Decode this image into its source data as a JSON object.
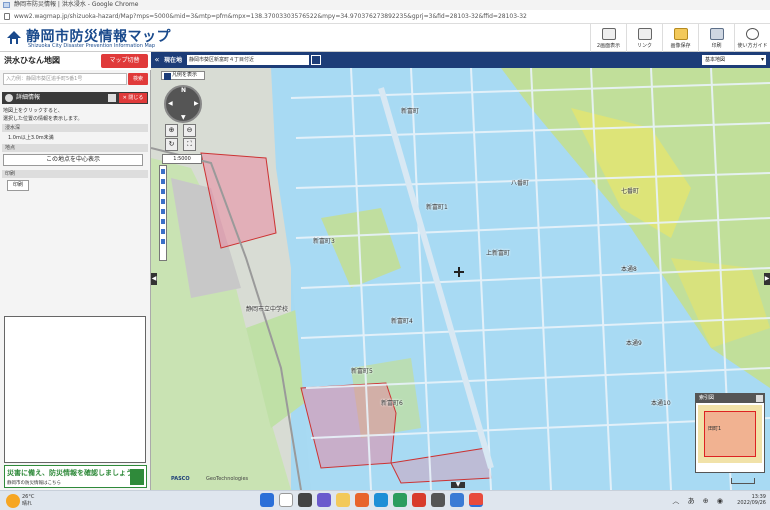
{
  "browser": {
    "title": "静岡市防災情報 | 洪水浸水 - Google Chrome",
    "url": "www2.wagmap.jp/shizuoka-hazard/Map?mps=5000&mid=3&mtp=pfm&mpx=138.37003303576522&mpy=34.970376273892235&gprj=3&fid=28103-32&ffid=28103-32"
  },
  "header": {
    "title": "静岡市防災情報マップ",
    "subtitle": "Shizuoka City Disaster Prevention Information Map",
    "buttons": [
      {
        "label": "2画面表示",
        "icon": "dual-screen-icon"
      },
      {
        "label": "リンク",
        "icon": "link-icon"
      },
      {
        "label": "画像保存",
        "icon": "folder-icon"
      },
      {
        "label": "印刷",
        "icon": "print-icon"
      },
      {
        "label": "使い方ガイド",
        "icon": "guide-icon"
      }
    ]
  },
  "sidebar": {
    "title": "洪水ひなん地図",
    "map_switch": "マップ切替",
    "search_placeholder": "入力例：静岡市葵区追手町5番1号",
    "search_button": "検索",
    "detail_title": "詳細情報",
    "close_label": "閉じる",
    "info_line1": "地図上をクリックすると、",
    "info_line2": "選択した位置の情報を表示します。",
    "section_depth": "浸水深",
    "depth_value": "1.0m以上3.0m未満",
    "section_point": "地点",
    "center_button": "この地点を中心表示",
    "section_print": "印刷",
    "print_button": "印刷",
    "banner_main": "災害に備え、防災情報を確認しましょう！",
    "banner_sub": "静岡市の防災情報はこちら"
  },
  "map_toolbar": {
    "current_label": "現在地",
    "current_value": "静岡市葵区新富町４丁目付近",
    "basemap": "基本地図"
  },
  "map": {
    "legend_tab": "凡例を表示",
    "scale": "1:5000",
    "labels": [
      {
        "text": "新富町",
        "id": "label-shintomicho"
      },
      {
        "text": "新富町1",
        "id": "label-shintomicho-1"
      },
      {
        "text": "新富町3",
        "id": "label-shintomicho-3"
      },
      {
        "text": "新富町4",
        "id": "label-shintomicho-4"
      },
      {
        "text": "新富町5",
        "id": "label-shintomicho-5"
      },
      {
        "text": "新富町6",
        "id": "label-shintomicho-6"
      },
      {
        "text": "上新富町",
        "id": "label-kamishintomicho"
      },
      {
        "text": "八番町",
        "id": "label-hachibancho"
      },
      {
        "text": "七番町",
        "id": "label-nanabancho"
      },
      {
        "text": "本通8",
        "id": "label-hondori-8"
      },
      {
        "text": "本通9",
        "id": "label-hondori-9"
      },
      {
        "text": "本通10",
        "id": "label-hondori-10"
      },
      {
        "text": "静岡市立中学校",
        "id": "label-school"
      }
    ],
    "overview_title": "索引図",
    "overview_text": "田町1",
    "credit_pasco": "PASCO",
    "credit_geo": "GeoTechnologies"
  },
  "taskbar": {
    "weather_temp": "26°C",
    "weather_desc": "晴れ",
    "time": "13:39",
    "date": "2022/09/26"
  }
}
